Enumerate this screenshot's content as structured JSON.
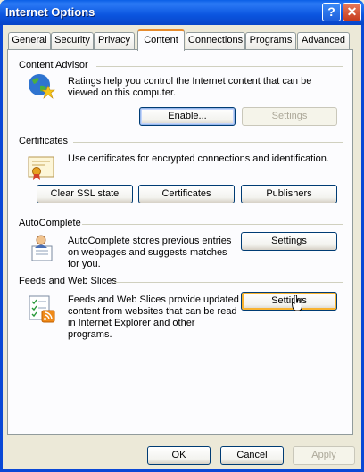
{
  "window": {
    "title": "Internet Options",
    "help_glyph": "?",
    "close_glyph": "✕"
  },
  "tabs": [
    {
      "label": "General"
    },
    {
      "label": "Security"
    },
    {
      "label": "Privacy"
    },
    {
      "label": "Content",
      "active": true
    },
    {
      "label": "Connections"
    },
    {
      "label": "Programs"
    },
    {
      "label": "Advanced"
    }
  ],
  "content_advisor": {
    "heading": "Content Advisor",
    "description": "Ratings help you control the Internet content that can be viewed on this computer.",
    "enable_label": "Enable...",
    "settings_label": "Settings"
  },
  "certificates": {
    "heading": "Certificates",
    "description": "Use certificates for encrypted connections and identification.",
    "clear_ssl_label": "Clear SSL state",
    "certificates_label": "Certificates",
    "publishers_label": "Publishers"
  },
  "autocomplete": {
    "heading": "AutoComplete",
    "description": "AutoComplete stores previous entries on webpages and suggests matches for you.",
    "settings_label": "Settings"
  },
  "feeds": {
    "heading": "Feeds and Web Slices",
    "description": "Feeds and Web Slices provide updated content from websites that can be read in Internet Explorer and other programs.",
    "settings_label": "Settings"
  },
  "footer": {
    "ok_label": "OK",
    "cancel_label": "Cancel",
    "apply_label": "Apply"
  },
  "colors": {
    "title_bar": "#0a5fe6",
    "dialog_bg": "#ece9d8",
    "panel_bg": "#fcfcfe",
    "active_tab_accent": "#e68b2c"
  }
}
